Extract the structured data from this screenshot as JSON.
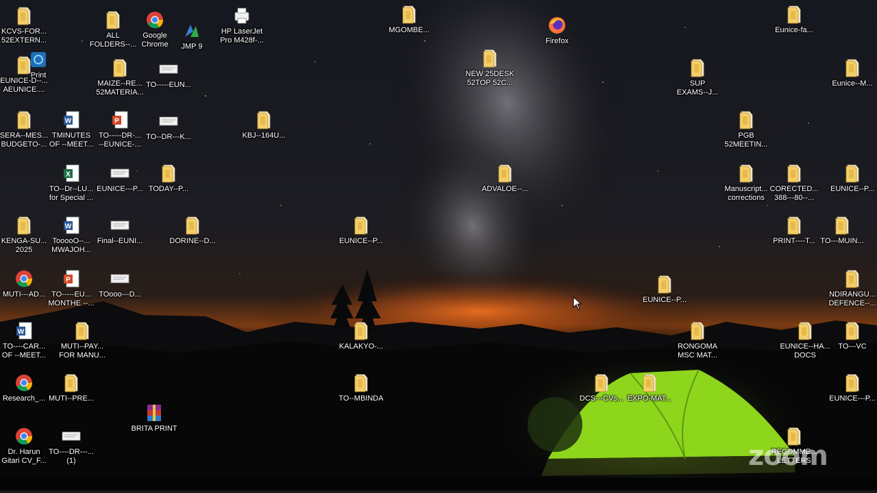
{
  "colors": {
    "sky_top": "#14161c",
    "milky_way": "#8c8a90",
    "horizon_glow": "#e8651a",
    "tent_green": "#8ed61c",
    "folder_yellow": "#f3cf6b",
    "label_text": "#ffffff"
  },
  "watermark": "zoom",
  "icons": [
    {
      "name": "folder-kcvs-forms-icon",
      "type": "folder",
      "label": "KCVS-FOR...\n52EXTERN..."
    },
    {
      "name": "folder-all-folders-icon",
      "type": "folder",
      "label": "ALL\nFOLDERS--..."
    },
    {
      "name": "google-chrome-icon",
      "type": "chrome",
      "label": "Google\nChrome"
    },
    {
      "name": "jmp-9-icon",
      "type": "jmp",
      "label": "JMP 9"
    },
    {
      "name": "hp-laserjet-icon",
      "type": "printer",
      "label": "HP LaserJet\nPro M428f-..."
    },
    {
      "name": "folder-mgombe-icon",
      "type": "folder",
      "label": "MGOMBE..."
    },
    {
      "name": "firefox-icon",
      "type": "firefox",
      "label": "Firefox"
    },
    {
      "name": "folder-eunice-fa-icon",
      "type": "folder",
      "label": "Eunice-fa..."
    },
    {
      "name": "print-shortcut-icon",
      "type": "print",
      "label": "Print"
    },
    {
      "name": "folder-eunice-desktop-icon",
      "type": "folder",
      "label": "EUNICE-D--...\nAEUNICE...."
    },
    {
      "name": "folder-maize-research-icon",
      "type": "folder",
      "label": "MAIZE--RE...\n52MATERIA..."
    },
    {
      "name": "file-to-eun-icon",
      "type": "generic",
      "label": "TO-----EUN..."
    },
    {
      "name": "folder-new-desktop-icon",
      "type": "folder",
      "label": "NEW 25DESK\n52TOP 52C..."
    },
    {
      "name": "folder-sup-exams-icon",
      "type": "folder",
      "label": "SUP\nEXAMS--J..."
    },
    {
      "name": "folder-eunice-m-icon",
      "type": "folder",
      "label": "Eunice--M..."
    },
    {
      "name": "folder-sera-mes-icon",
      "type": "folder",
      "label": "SERA--MES...\nBUDGETO-..."
    },
    {
      "name": "word-minutes-icon",
      "type": "word",
      "label": "TMINUTES\nOF --MEET..."
    },
    {
      "name": "ppt-to-dr-eunice-icon",
      "type": "ppt",
      "label": "TO-----DR-...\n--EUNICE-..."
    },
    {
      "name": "file-to-dr-k-icon",
      "type": "generic",
      "label": "TO--DR---K..."
    },
    {
      "name": "folder-kbj-icon",
      "type": "folder",
      "label": "KBJ--164U..."
    },
    {
      "name": "folder-pgb-meeting-icon",
      "type": "folder",
      "label": "PGB\n52MEETIN..."
    },
    {
      "name": "excel-to-dr-lu-icon",
      "type": "excel",
      "label": "TO--Dr--LU...\nfor Special ..."
    },
    {
      "name": "file-eunice-p-icon",
      "type": "generic",
      "label": "EUNICE---P..."
    },
    {
      "name": "folder-today-icon",
      "type": "folder",
      "label": "TODAY--P..."
    },
    {
      "name": "folder-advaloe-icon",
      "type": "folder",
      "label": "ADVALOE--..."
    },
    {
      "name": "folder-manuscript-icon",
      "type": "folder",
      "label": "Manuscript...\ncorrections"
    },
    {
      "name": "folder-corected-icon",
      "type": "folder",
      "label": "CORECTED...\n388---80--..."
    },
    {
      "name": "folder-eunice-p-right-icon",
      "type": "folder",
      "label": "EUNICE--P..."
    },
    {
      "name": "folder-kenga-icon",
      "type": "folder",
      "label": "KENGA-SU...\n2025"
    },
    {
      "name": "word-mwajoh-icon",
      "type": "word",
      "label": "TooooO--...\nMWAJOH..."
    },
    {
      "name": "file-final-euni-icon",
      "type": "generic",
      "label": "Final--EUNI..."
    },
    {
      "name": "folder-dorine-icon",
      "type": "folder",
      "label": "DORINE--D..."
    },
    {
      "name": "folder-eunice-p-center-icon",
      "type": "folder",
      "label": "EUNICE--P..."
    },
    {
      "name": "folder-print-t-icon",
      "type": "folder",
      "label": "PRINT----T..."
    },
    {
      "name": "folder-to-muin-icon",
      "type": "folder",
      "label": "TO---MUIN..."
    },
    {
      "name": "chrome-muti-ad-icon",
      "type": "chrome",
      "label": "MUTI---AD..."
    },
    {
      "name": "ppt-monthe-icon",
      "type": "ppt",
      "label": "TO-----EU...\nMONTHE --..."
    },
    {
      "name": "file-toooo-d-icon",
      "type": "generic",
      "label": "TOooo---D..."
    },
    {
      "name": "folder-eunice-p-mid-icon",
      "type": "folder",
      "label": "EUNICE--P..."
    },
    {
      "name": "folder-ndirangu-icon",
      "type": "folder",
      "label": "NDIRANGU...\nDEFENCE--..."
    },
    {
      "name": "word-to-car-icon",
      "type": "word",
      "label": "TO----CAR...\nOF --MEET..."
    },
    {
      "name": "folder-muti-pay-icon",
      "type": "folder",
      "label": "MUTI--PAY...\nFOR MANU..."
    },
    {
      "name": "folder-kalakyo-icon",
      "type": "folder",
      "label": "KALAKYO-..."
    },
    {
      "name": "folder-rongoma-icon",
      "type": "folder",
      "label": "RONGOMA\nMSC MAT..."
    },
    {
      "name": "folder-eunice-ha-docs-icon",
      "type": "folder",
      "label": "EUNICE--HA...\nDOCS"
    },
    {
      "name": "folder-to-vc-icon",
      "type": "folder",
      "label": "TO---VC"
    },
    {
      "name": "chrome-research-icon",
      "type": "chrome",
      "label": "Research_..."
    },
    {
      "name": "folder-muti-pre-icon",
      "type": "folder",
      "label": "MUTI--PRE..."
    },
    {
      "name": "folder-to-mbinda-icon",
      "type": "folder",
      "label": "TO--MBINDA"
    },
    {
      "name": "folder-dcs-cvs-icon",
      "type": "folder",
      "label": "DCS---CVs..."
    },
    {
      "name": "folder-expo-mat-icon",
      "type": "folder",
      "label": "EXPO-MAT..."
    },
    {
      "name": "folder-eunice-p-bottom-icon",
      "type": "folder",
      "label": "EUNICE---P..."
    },
    {
      "name": "winrar-brita-print-icon",
      "type": "winrar",
      "label": "BRITA PRINT"
    },
    {
      "name": "chrome-harun-cv-icon",
      "type": "chrome",
      "label": "Dr. Harun\nGitari CV_F..."
    },
    {
      "name": "file-to-dr-1-icon",
      "type": "generic",
      "label": "TO----DR---...\n(1)"
    },
    {
      "name": "folder-recommend-letters-icon",
      "type": "folder",
      "label": "RECOMME...\nLETTERS"
    }
  ]
}
